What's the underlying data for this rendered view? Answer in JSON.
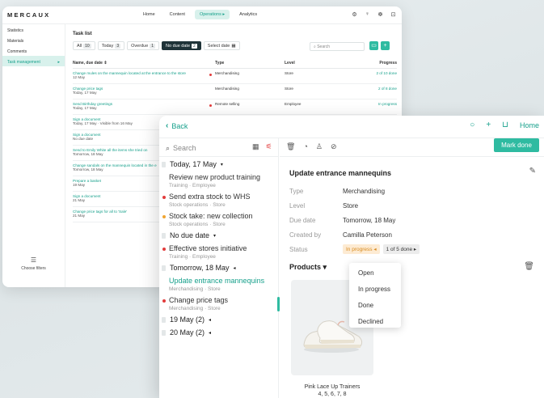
{
  "back": {
    "logo": "MERCAUX",
    "nav": [
      "Home",
      "Content",
      "Operations ▸",
      "Analytics"
    ],
    "nav_active": 2,
    "icons": [
      "⚙",
      "♀",
      "☸",
      "⊡"
    ],
    "sidebar": [
      {
        "label": "Statistics"
      },
      {
        "label": "Materials"
      },
      {
        "label": "Comments"
      },
      {
        "label": "Task management",
        "arrow": "▸"
      }
    ],
    "filters_label": "Choose filters",
    "title": "Task list",
    "tabs": [
      {
        "label": "All",
        "count": "10"
      },
      {
        "label": "Today",
        "count": "3"
      },
      {
        "label": "Overdue",
        "count": "1"
      },
      {
        "label": "No due date",
        "count": "2"
      },
      {
        "label": "Select date",
        "count": "▦"
      }
    ],
    "search_placeholder": "Search",
    "columns": [
      "Name, due date ⇕",
      "Type",
      "Level",
      "Progress"
    ],
    "rows": [
      {
        "name": "Change mules on the mannequin located at the entrance to the store",
        "sub": "12 May",
        "type": "Merchandising",
        "level": "Store",
        "progress": "2 of 10 done",
        "dot": true
      },
      {
        "name": "Change price tags",
        "sub": "Today, 17 May",
        "type": "Merchandising",
        "level": "Store",
        "progress": "2 of 8 done",
        "dot": false
      },
      {
        "name": "Send Birthday greetings",
        "sub": "Today, 17 May",
        "type": "Remote selling",
        "level": "Employee",
        "progress": "In progress",
        "dot": true
      },
      {
        "name": "Sign a document",
        "sub": "Today, 17 May · Visible from 16 May",
        "type": "",
        "level": "",
        "progress": "",
        "dot": false
      },
      {
        "name": "Sign a document",
        "sub": "No due date",
        "type": "",
        "level": "",
        "progress": "",
        "dot": false
      },
      {
        "name": "Send to Emily White all the items she tried on",
        "sub": "Tomorrow, 18 May",
        "type": "",
        "level": "",
        "progress": "",
        "dot": false
      },
      {
        "name": "Change sandals on the mannequin located in the e",
        "sub": "Tomorrow, 18 May",
        "type": "",
        "level": "",
        "progress": "",
        "dot": false
      },
      {
        "name": "Prepare a basket",
        "sub": "19 May",
        "type": "",
        "level": "",
        "progress": "",
        "dot": false
      },
      {
        "name": "Sign a document",
        "sub": "21 May",
        "type": "",
        "level": "",
        "progress": "",
        "dot": false
      },
      {
        "name": "Change price tags for all to 'Sale'",
        "sub": "21 May",
        "type": "",
        "level": "",
        "progress": "",
        "dot": false
      }
    ]
  },
  "front": {
    "back_label": "Back",
    "home_label": "Home",
    "search_placeholder": "Search",
    "mark_done": "Mark done",
    "groups": [
      {
        "label": "Today, 17 May",
        "arrow": "▾",
        "tasks": [
          {
            "title": "Review new product training",
            "sub": "Training · Employee",
            "dot": ""
          },
          {
            "title": "Send extra stock to WHS",
            "sub": "Stock operations · Store",
            "dot": "#e23b3b"
          },
          {
            "title": "Stock take: new collection",
            "sub": "Stock operations · Store",
            "dot": "#f0a531"
          }
        ]
      },
      {
        "label": "No due date",
        "arrow": "▾",
        "tasks": [
          {
            "title": "Effective stores initiative",
            "sub": "Training · Employee",
            "dot": "#e23b3b"
          }
        ]
      },
      {
        "label": "Tomorrow, 18 May",
        "arrow": "◂",
        "tasks": [
          {
            "title": "Update entrance mannequins",
            "sub": "Merchandising · Store",
            "dot": "",
            "selected": true
          },
          {
            "title": "Change price tags",
            "sub": "Merchandising · Store",
            "dot": "#e23b3b"
          }
        ]
      },
      {
        "label": "19 May (2)",
        "arrow": "◂",
        "tasks": []
      },
      {
        "label": "20 May (2)",
        "arrow": "◂",
        "tasks": []
      }
    ],
    "detail": {
      "title": "Update entrance mannequins",
      "rows": [
        {
          "k": "Type",
          "v": "Merchandising"
        },
        {
          "k": "Level",
          "v": "Store"
        },
        {
          "k": "Due date",
          "v": "Tomorrow, 18 May"
        },
        {
          "k": "Created by",
          "v": "Camilla Peterson"
        }
      ],
      "status_label": "Status",
      "status_value": "In progress ◂",
      "progress_value": "1 of 5 done ▸",
      "products_label": "Products ▾",
      "product_name": "Pink Lace Up Trainers",
      "product_sizes": "4, 5, 6, 7, 8",
      "status_options": [
        "Open",
        "In progress",
        "Done",
        "Declined"
      ]
    }
  },
  "colors": {
    "accent": "#2fbba1",
    "accent_text": "#16a08b",
    "danger": "#e23b3b",
    "warning": "#f0a531"
  }
}
